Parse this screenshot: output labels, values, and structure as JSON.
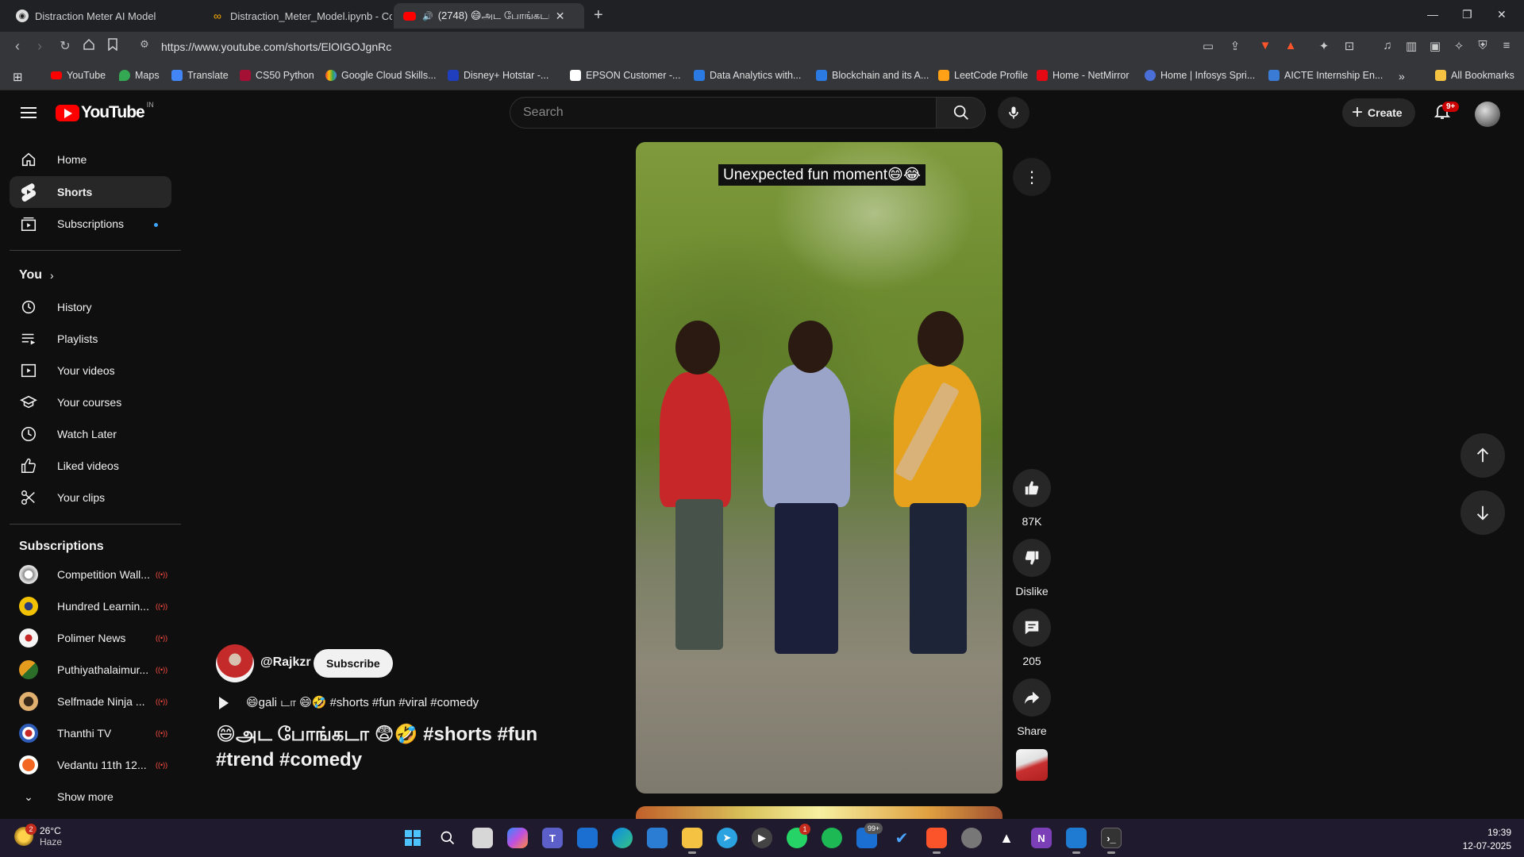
{
  "browser": {
    "tabs": [
      {
        "title": "Distraction Meter AI Model",
        "icon": "brave-icon"
      },
      {
        "title": "Distraction_Meter_Model.ipynb - Col",
        "icon": "colab-icon"
      },
      {
        "title": "(2748) 😄அட போங்கடா 🤦",
        "icon": "youtube-icon"
      }
    ],
    "url": "https://www.youtube.com/shorts/ElOIGOJgnRc",
    "bookmarks": [
      {
        "label": "YouTube",
        "color": "#ff0000"
      },
      {
        "label": "Maps",
        "color": "#34a853"
      },
      {
        "label": "Translate",
        "color": "#4285f4"
      },
      {
        "label": "CS50 Python",
        "color": "#a41034"
      },
      {
        "label": "Google Cloud Skills...",
        "color": "#fbbc04"
      },
      {
        "label": "Disney+ Hotstar -...",
        "color": "#1f3fbf"
      },
      {
        "label": "EPSON Customer -...",
        "color": "#ffffff"
      },
      {
        "label": "Data Analytics with...",
        "color": "#2a7ae2"
      },
      {
        "label": "Blockchain and its A...",
        "color": "#2a7ae2"
      },
      {
        "label": "LeetCode Profile",
        "color": "#ffa116"
      },
      {
        "label": "Home - NetMirror",
        "color": "#e50914"
      },
      {
        "label": "Home | Infosys Spri...",
        "color": "#4a6fd8"
      },
      {
        "label": "AICTE Internship En...",
        "color": "#3a7bd5"
      }
    ],
    "all_bookmarks": "All Bookmarks"
  },
  "youtube": {
    "logo_text": "YouTube",
    "country_code": "IN",
    "search_placeholder": "Search",
    "create_label": "Create",
    "notification_count": "9+",
    "sidebar": {
      "main": [
        {
          "label": "Home",
          "icon": "home-icon"
        },
        {
          "label": "Shorts",
          "icon": "shorts-icon"
        },
        {
          "label": "Subscriptions",
          "icon": "subscriptions-icon"
        }
      ],
      "you_heading": "You",
      "you_items": [
        {
          "label": "History",
          "icon": "history-icon"
        },
        {
          "label": "Playlists",
          "icon": "playlists-icon"
        },
        {
          "label": "Your videos",
          "icon": "your-videos-icon"
        },
        {
          "label": "Your courses",
          "icon": "courses-icon"
        },
        {
          "label": "Watch Later",
          "icon": "clock-icon"
        },
        {
          "label": "Liked videos",
          "icon": "thumbs-up-icon"
        },
        {
          "label": "Your clips",
          "icon": "scissors-icon"
        }
      ],
      "subscriptions_heading": "Subscriptions",
      "subscriptions": [
        {
          "name": "Competition Wall...",
          "live": "((•))",
          "color": "#dcdcdc"
        },
        {
          "name": "Hundred Learnin...",
          "live": "((•))",
          "color": "#f2c200"
        },
        {
          "name": "Polimer News",
          "live": "((•))",
          "color": "#e8e8e8"
        },
        {
          "name": "Puthiyathalaimur...",
          "live": "((•))",
          "color": "#e49b1e"
        },
        {
          "name": "Selfmade Ninja ...",
          "live": "((•))",
          "color": "#e0b070"
        },
        {
          "name": "Thanthi TV",
          "live": "((•))",
          "color": "#2c5bb8"
        },
        {
          "name": "Vedantu 11th 12...",
          "live": "((•))",
          "color": "#f26722"
        }
      ],
      "show_more": "Show more"
    },
    "short": {
      "caption": "Unexpected fun moment😄😂",
      "channel": "@Rajkzr",
      "subscribe_label": "Subscribe",
      "audio_text": "😄gali டா 😄🤣 #shorts #fun #viral #comedy",
      "title": "😄அட போங்கடா 😨🤣 #shorts #fun #trend #comedy",
      "likes": "87K",
      "dislike_label": "Dislike",
      "comments": "205",
      "share_label": "Share"
    }
  },
  "taskbar": {
    "weather_temp": "26°C",
    "weather_desc": "Haze",
    "weather_badge": "2",
    "whatsapp_badge": "1",
    "mail_badge": "99+",
    "time": "19:39",
    "date": "12-07-2025"
  }
}
